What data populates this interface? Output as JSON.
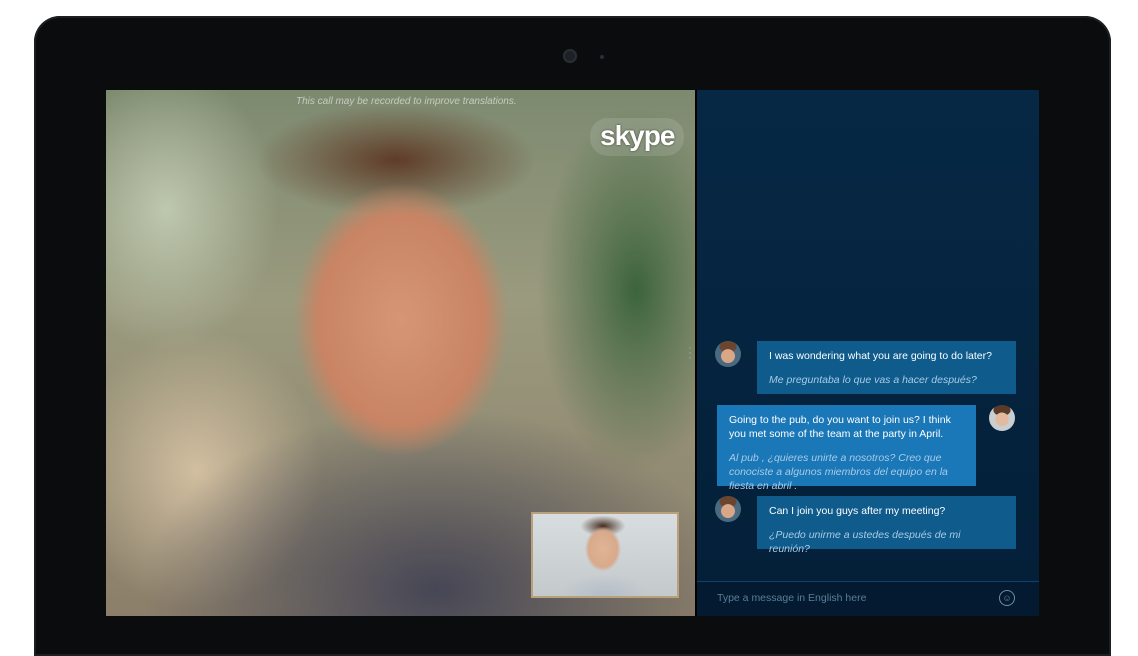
{
  "call": {
    "disclaimer": "This call may be recorded to improve translations.",
    "logo_text": "skype"
  },
  "messages": [
    {
      "direction": "incoming",
      "original": "I was wondering what you are going to do later?",
      "translation": "Me preguntaba lo que vas a hacer después?"
    },
    {
      "direction": "outgoing",
      "original": "Going to the pub, do you want to join us? I think you met some of the team at the party in April.",
      "translation": "Al pub , ¿quieres unirte a nosotros? Creo que conociste a algunos miembros del equipo en la fiesta en abril ."
    },
    {
      "direction": "incoming",
      "original": "Can I join you guys after my meeting?",
      "translation": "¿Puedo unirme a ustedes después de mi reunión?"
    }
  ],
  "composer": {
    "placeholder": "Type a message in English here",
    "emoji_icon": "smiley-icon"
  },
  "colors": {
    "chat_bg": "#062845",
    "incoming_bubble": "#0e5b8c",
    "outgoing_bubble": "#1a77b8",
    "translation_text": "#a9cbe6"
  }
}
